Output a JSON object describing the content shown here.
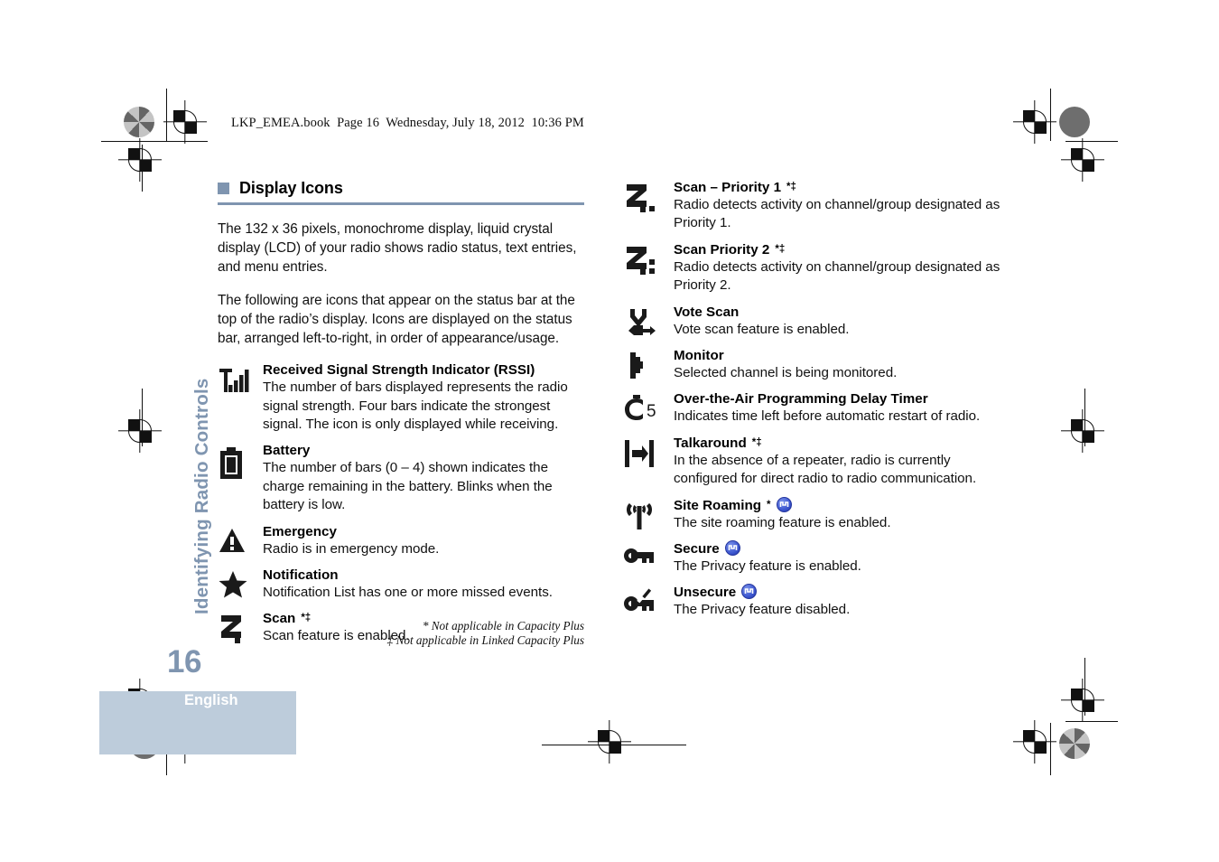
{
  "header": {
    "book_line": "LKP_EMEA.book  Page 16  Wednesday, July 18, 2012  10:36 PM"
  },
  "sidebar": {
    "chapter_title": "Identifying Radio Controls",
    "accent_color": "#7f95b0"
  },
  "footer": {
    "page_number": "16",
    "language": "English",
    "block_color": "#bdccdb"
  },
  "section": {
    "heading": "Display Icons",
    "paragraphs": [
      "The 132 x 36 pixels, monochrome display, liquid crystal display (LCD) of your radio shows radio status, text entries, and menu entries.",
      "The following are icons that appear on the status bar at the top of the radio’s display. Icons are displayed on the status bar, arranged left-to-right, in order of appearance/usage."
    ]
  },
  "left_entries": [
    {
      "icon": "rssi-signal-bars-icon",
      "title": "Received Signal Strength Indicator (RSSI)",
      "sup": "",
      "badge": false,
      "desc": "The number of bars displayed represents the radio signal strength. Four bars indicate the strongest signal. The icon is only displayed while receiving."
    },
    {
      "icon": "battery-icon",
      "title": "Battery",
      "sup": "",
      "badge": false,
      "desc": "The number of bars (0 – 4) shown indicates the charge remaining in the battery. Blinks when the battery is low."
    },
    {
      "icon": "emergency-warning-triangle-icon",
      "title": "Emergency",
      "sup": "",
      "badge": false,
      "desc": "Radio is in emergency mode."
    },
    {
      "icon": "notification-star-icon",
      "title": "Notification",
      "sup": "",
      "badge": false,
      "desc": "Notification List has one or more missed events."
    },
    {
      "icon": "scan-z-icon",
      "title": "Scan",
      "sup": "*‡",
      "badge": false,
      "desc": "Scan feature is enabled."
    }
  ],
  "right_entries": [
    {
      "icon": "scan-priority-1-icon",
      "title": "Scan – Priority 1",
      "sup": "*‡",
      "badge": false,
      "desc": "Radio detects activity on channel/group designated as Priority 1."
    },
    {
      "icon": "scan-priority-2-icon",
      "title": "Scan Priority 2",
      "sup": "*‡",
      "badge": false,
      "desc": "Radio detects activity on channel/group designated as Priority 2."
    },
    {
      "icon": "vote-scan-icon",
      "title": "Vote Scan",
      "sup": "",
      "badge": false,
      "desc": "Vote scan feature is enabled."
    },
    {
      "icon": "monitor-flag-icon",
      "title": "Monitor",
      "sup": "",
      "badge": false,
      "desc": "Selected channel is being monitored."
    },
    {
      "icon": "ota-programming-delay-timer-icon",
      "title": "Over-the-Air Programming Delay Timer",
      "sup": "",
      "badge": false,
      "desc": "Indicates time left before automatic restart of radio."
    },
    {
      "icon": "talkaround-icon",
      "title": "Talkaround",
      "sup": "*‡",
      "badge": false,
      "desc": "In the absence of a repeater, radio is currently configured for direct radio to radio communication."
    },
    {
      "icon": "site-roaming-antenna-icon",
      "title": "Site Roaming",
      "sup": "*",
      "badge": true,
      "desc": "The site roaming feature is enabled."
    },
    {
      "icon": "secure-key-icon",
      "title": "Secure",
      "sup": "",
      "badge": true,
      "desc": "The Privacy feature is enabled."
    },
    {
      "icon": "unsecure-broken-key-icon",
      "title": "Unsecure",
      "sup": "",
      "badge": true,
      "desc": "The Privacy feature disabled."
    }
  ],
  "footnotes": [
    "* Not applicable in Capacity Plus",
    "‡ Not applicable in Linked Capacity Plus"
  ]
}
